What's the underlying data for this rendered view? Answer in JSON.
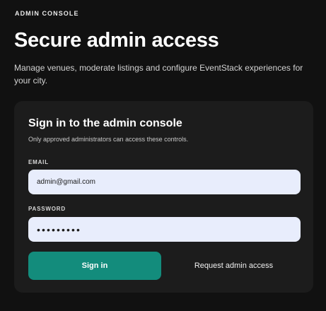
{
  "header": {
    "eyebrow": "ADMIN CONSOLE",
    "title": "Secure admin access",
    "subtitle": "Manage venues, moderate listings and configure EventStack experiences for your city."
  },
  "login_card": {
    "title": "Sign in to the admin console",
    "subtitle": "Only approved administrators can access these controls.",
    "email_label": "EMAIL",
    "email_value": "admin@gmail.com",
    "password_label": "PASSWORD",
    "password_value": "123456789",
    "signin_label": "Sign in",
    "request_access_label": "Request admin access"
  },
  "colors": {
    "background": "#111111",
    "card": "#1c1c1c",
    "input": "#e8edfc",
    "accent": "#138c7c"
  }
}
